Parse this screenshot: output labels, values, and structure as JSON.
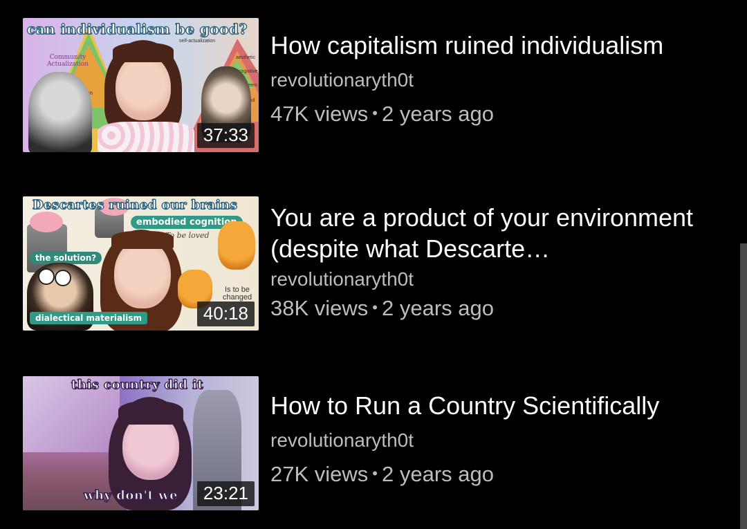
{
  "videos": [
    {
      "title": "How capitalism ruined individualism",
      "channel": "revolutionaryth0t",
      "views": "47K views",
      "age": "2 years ago",
      "duration": "37:33",
      "thumb_text": {
        "headline": "can individualism be good?",
        "pyramid_label": "Community Actualization",
        "right_labels": [
          "self-actualization",
          "aesthetic",
          "cognitive",
          "esteem",
          "ng and"
        ],
        "left_label": "on"
      }
    },
    {
      "title": "You are a product of your environment (despite what Descarte…",
      "channel": "revolutionaryth0t",
      "views": "38K views",
      "age": "2 years ago",
      "duration": "40:18",
      "thumb_text": {
        "headline": "Descartes ruined our brains",
        "pill_1": "embodied cognition",
        "pill_2": "the solution?",
        "pill_3": "dialectical materialism",
        "script": "To be loved",
        "note": "Is to be changed"
      }
    },
    {
      "title": "How to Run a Country Scientifically",
      "channel": "revolutionaryth0t",
      "views": "27K views",
      "age": "2 years ago",
      "duration": "23:21",
      "thumb_text": {
        "top": "this country did it",
        "bottom": "why don't we"
      }
    }
  ],
  "colors": {
    "background": "#000000",
    "secondary_text": "#bdbdbd",
    "accent_teal": "#2f9a86"
  }
}
